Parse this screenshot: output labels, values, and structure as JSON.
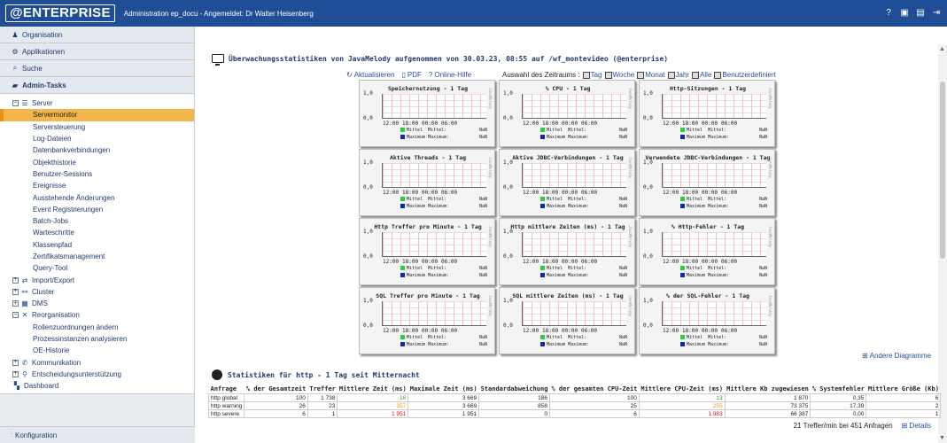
{
  "header": {
    "logo": "@ENTERPRISE",
    "title": "Administration ep_docu - Angemeldet: Dr Walter Heisenberg"
  },
  "sidebar": {
    "sections_top": [
      "Organisation",
      "Applikationen",
      "Suche"
    ],
    "admin": "Admin-Tasks",
    "server": "Server",
    "server_items": [
      "Servermonitor",
      "Serversteuerung",
      "Log-Dateien",
      "Datenbankverbindungen",
      "Objekthistorie",
      "Benutzer-Sessions",
      "Ereignisse",
      "Ausstehende Änderungen",
      "Event Registrierungen",
      "Batch-Jobs",
      "Warteschritte",
      "Klassenpfad",
      "Zertifikatsmanagement",
      "Query-Tool"
    ],
    "groups": [
      "Import/Export",
      "Cluster",
      "DMS"
    ],
    "reorg": "Reorganisation",
    "reorg_items": [
      "Rollenzuordnungen ändern",
      "Prozessinstanzen analysieren",
      "OE-Historie"
    ],
    "groups2": [
      "Kommunikation",
      "Entscheidungsunterstützung"
    ],
    "dashboard": "Dashboard",
    "bottom": "Konfiguration"
  },
  "main": {
    "title": "Überwachungsstatistiken von JavaMelody aufgenommen von 30.03.23, 08:55 auf /wf_montevideo (@enterprise)",
    "actions": [
      "Aktualisieren",
      "PDF",
      "Online-Hilfe"
    ],
    "period_label": "Auswahl des Zeitraums :",
    "periods": [
      "Tag",
      "Woche",
      "Monat",
      "Jahr",
      "Alle",
      "Benutzerdefiniert"
    ],
    "more_diagrams": "Andere Diagramme",
    "stats_title": "Statistiken für http - 1 Tag seit Mitternacht",
    "summary": "21 Treffer/min bei 451 Anfragen",
    "details": "Details"
  },
  "chart_common": {
    "y_top": "1,0",
    "y_bottom": "0,0",
    "x_ticks": [
      "12:00",
      "18:00",
      "00:00",
      "06:00"
    ],
    "legend_mean": "Mittel",
    "legend_mean_label": "Mittel:",
    "legend_max": "Maximum",
    "legend_max_label": "Maximum:",
    "value": "NaN",
    "side": "JavaMelody",
    "colors": {
      "mean": "#2ecc40",
      "max": "#0b2ba8"
    }
  },
  "charts": [
    "Speichernutzung - 1 Tag",
    "% CPU - 1 Tag",
    "Http-Sitzungen - 1 Tag",
    "Aktive Threads - 1 Tag",
    "Aktive JDBC-Verbindungen - 1 Tag",
    "Verwendete JDBC-Verbindungen - 1 Tag",
    "Http Treffer pro Minute - 1 Tag",
    "Http mittlere Zeiten (ms) - 1 Tag",
    "% Http-Fehler - 1 Tag",
    "SQL Treffer pro Minute - 1 Tag",
    "SQL mittlere Zeiten (ms) - 1 Tag",
    "% der SQL-Fehler - 1 Tag"
  ],
  "table": {
    "headers": [
      "Anfrage",
      "% der Gesamtzeit",
      "Treffer",
      "Mittlere Zeit (ms)",
      "Maximale Zeit (ms)",
      "Standardabweichung",
      "% der gesamten CPU-Zeit",
      "Mittlere CPU-Zeit (ms)",
      "Mittlere Kb zugewiesen",
      "% Systemfehler",
      "Mittlere Größe (Kb)"
    ],
    "rows": [
      {
        "name": "http global",
        "cells": [
          "100",
          "1 738",
          "18",
          "3 669",
          "186",
          "100",
          "13",
          "1 870",
          "0,35",
          "6"
        ],
        "mean_color": "#2a9d2a",
        "cpu_color": "#2a9d2a"
      },
      {
        "name": "http warning",
        "cells": [
          "26",
          "23",
          "357",
          "3 669",
          "858",
          "25",
          "255",
          "73 375",
          "17,39",
          "2"
        ],
        "mean_color": "#e69514",
        "cpu_color": "#e69514"
      },
      {
        "name": "http severe",
        "cells": [
          "6",
          "1",
          "1 951",
          "1 951",
          "0",
          "6",
          "1 983",
          "66 387",
          "0,00",
          "1"
        ],
        "mean_color": "#d41010",
        "cpu_color": "#d41010"
      }
    ]
  }
}
